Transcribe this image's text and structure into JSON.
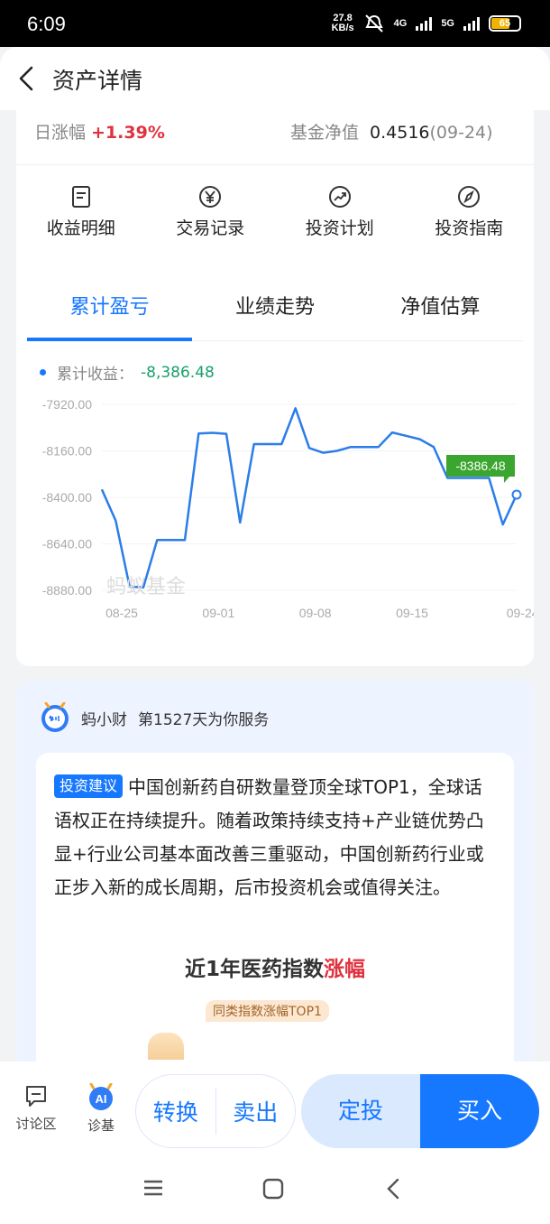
{
  "status_bar": {
    "time": "6:09",
    "net_speed_value": "27.8",
    "net_speed_unit": "KB/s",
    "signal_1": "4G",
    "signal_2": "5G",
    "battery": "65"
  },
  "header": {
    "title": "资产详情"
  },
  "metrics": {
    "daily_change_label": "日涨幅",
    "daily_change_value": "+1.39%",
    "nav_label": "基金净值",
    "nav_value": "0.4516",
    "nav_date": "(09-24)"
  },
  "actions": [
    {
      "label": "收益明细",
      "icon": "document-icon"
    },
    {
      "label": "交易记录",
      "icon": "yuan-icon"
    },
    {
      "label": "投资计划",
      "icon": "trend-icon"
    },
    {
      "label": "投资指南",
      "icon": "compass-icon"
    }
  ],
  "tabs": [
    {
      "label": "累计盈亏",
      "active": true
    },
    {
      "label": "业绩走势",
      "active": false
    },
    {
      "label": "净值估算",
      "active": false
    }
  ],
  "chart_legend": {
    "label": "累计收益：",
    "value": "-8,386.48"
  },
  "chart_data": {
    "type": "line",
    "ylim": [
      -8880,
      -7920
    ],
    "y_ticks": [
      "-7920.00",
      "-8160.00",
      "-8400.00",
      "-8640.00",
      "-8880.00"
    ],
    "x_ticks": [
      "08-25",
      "09-01",
      "09-08",
      "09-15",
      "09-24"
    ],
    "series": [
      {
        "values": [
          -8360,
          -8520,
          -8860,
          -8865,
          -8620,
          -8620,
          -8620,
          -8070,
          -8067,
          -8072,
          -8530,
          -8125,
          -8125,
          -8125,
          -7940,
          -8145,
          -8170,
          -8160,
          -8140,
          -8140,
          -8140,
          -8065,
          -8082,
          -8100,
          -8140,
          -8300,
          -8300,
          -8300,
          -8300,
          -8540,
          -8386
        ]
      }
    ],
    "callout": "-8386.48",
    "line_color": "#2b7de9",
    "callout_color": "#3ba62f"
  },
  "watermark": "蚂蚁基金",
  "ai": {
    "name": "蚂小财",
    "service_text": "第1527天为你服务",
    "tag": "投资建议",
    "content": "中国创新药自研数量登顶全球TOP1，全球话语权正在持续提升。随着政策持续支持+产业链优势凸显+行业公司基本面改善三重驱动，中国创新药行业或正步入新的成长周期，后市投资机会或值得关注。",
    "subtitle_prefix": "近1年医药指数",
    "subtitle_highlight": "涨幅",
    "pill": "同类指数涨幅TOP1"
  },
  "bottom": {
    "discuss_label": "讨论区",
    "diagnose_label": "诊基",
    "switch_label": "转换",
    "sell_label": "卖出",
    "fixed_label": "定投",
    "buy_label": "买入"
  }
}
